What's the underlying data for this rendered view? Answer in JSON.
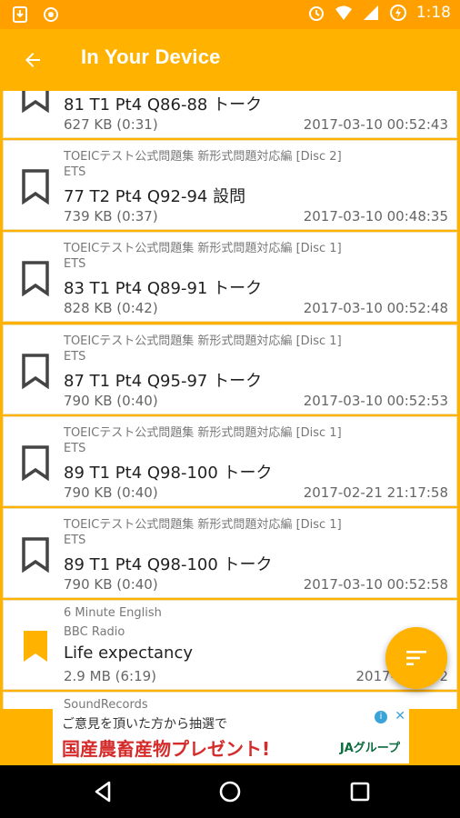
{
  "status_bar": {
    "time": "1:18",
    "left_icons": [
      "download-icon",
      "record-icon"
    ],
    "right_icons": [
      "alarm-icon",
      "wifi-icon",
      "signal-icon",
      "battery-charging-icon"
    ]
  },
  "app_bar": {
    "title": "In Your Device",
    "back_icon": "arrow-left-icon"
  },
  "list": [
    {
      "album": "",
      "artist": "",
      "track": "81 T1 Pt4 Q86-88 トーク",
      "size": "627 KB (0:31)",
      "date": "2017-03-10 00:52:43",
      "bookmarked": false
    },
    {
      "album": "TOEICテスト公式問題集 新形式問題対応編 [Disc 2]",
      "artist": "ETS",
      "track": "77 T2 Pt4 Q92-94 設問",
      "size": "739 KB (0:37)",
      "date": "2017-03-10 00:48:35",
      "bookmarked": false
    },
    {
      "album": "TOEICテスト公式問題集 新形式問題対応編 [Disc 1]",
      "artist": "ETS",
      "track": "83 T1 Pt4 Q89-91 トーク",
      "size": "828 KB (0:42)",
      "date": "2017-03-10 00:52:48",
      "bookmarked": false
    },
    {
      "album": "TOEICテスト公式問題集 新形式問題対応編 [Disc 1]",
      "artist": "ETS",
      "track": "87 T1 Pt4 Q95-97 トーク",
      "size": "790 KB (0:40)",
      "date": "2017-03-10 00:52:53",
      "bookmarked": false
    },
    {
      "album": "TOEICテスト公式問題集 新形式問題対応編 [Disc 1]",
      "artist": "ETS",
      "track": "89 T1 Pt4 Q98-100 トーク",
      "size": "790 KB (0:40)",
      "date": "2017-02-21 21:17:58",
      "bookmarked": false
    },
    {
      "album": "TOEICテスト公式問題集 新形式問題対応編 [Disc 1]",
      "artist": "ETS",
      "track": "89 T1 Pt4 Q98-100 トーク",
      "size": "790 KB (0:40)",
      "date": "2017-03-10 00:52:58",
      "bookmarked": false
    },
    {
      "album": "6 Minute English",
      "artist": "BBC Radio",
      "track": "Life expectancy",
      "size": "2.9 MB (6:19)",
      "date": "2017-03-14 2",
      "bookmarked": true
    },
    {
      "album": "SoundRecords",
      "artist": "",
      "track": "",
      "size": "",
      "date": "",
      "bookmarked": false
    }
  ],
  "fab": {
    "icon": "sort-icon"
  },
  "ad": {
    "line1": "ご意見を頂いた方から抽選で",
    "line2": "国産農畜産物プレゼント!",
    "brand": "JAグループ",
    "info": "i",
    "close": "✕"
  },
  "colors": {
    "accent": "#ffb300",
    "status_bar": "#ffa000",
    "bookmark_filled": "#ffb300",
    "bookmark_outline": "#444444"
  }
}
